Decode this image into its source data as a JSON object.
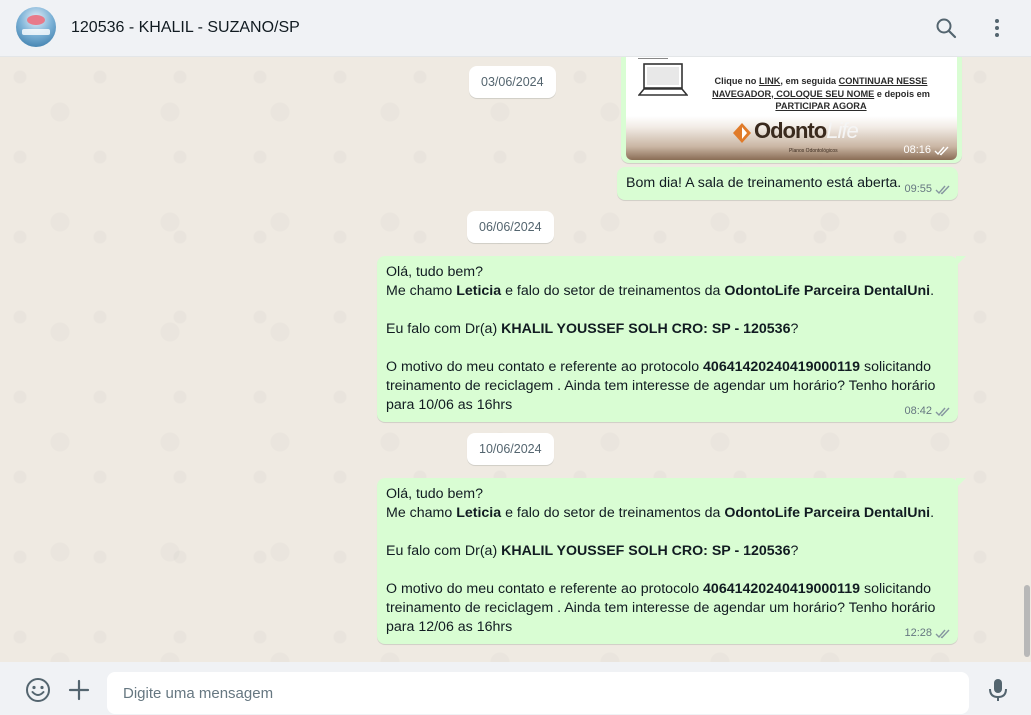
{
  "header": {
    "contact_name": "120536 - KHALIL - SUZANO/SP"
  },
  "image_message": {
    "instruction_lines": [
      [
        "Clique no ",
        "LINK",
        ", em seguida ",
        "CONTINUAR NESSE"
      ],
      [
        "NAVEGADOR, COLOQUE SEU NOME",
        " e depois em"
      ],
      [
        "PARTICIPAR AGORA"
      ]
    ],
    "brand_odonto": "Odonto",
    "brand_life": "Life",
    "brand_tagline": "Planos Odontológicos",
    "time": "08:16"
  },
  "dates": [
    "03/06/2024",
    "06/06/2024",
    "10/06/2024"
  ],
  "messages": [
    {
      "id": "m1",
      "time": "09:55",
      "lines": [
        [
          {
            "t": "Bom dia! A sala de treinamento está aberta.",
            "b": false
          }
        ]
      ]
    },
    {
      "id": "m2",
      "time": "08:42",
      "lines": [
        [
          {
            "t": "Olá, tudo bem?",
            "b": false
          }
        ],
        [
          {
            "t": "Me chamo ",
            "b": false
          },
          {
            "t": "Leticia",
            "b": true
          },
          {
            "t": " e falo do setor de treinamentos  da ",
            "b": false
          },
          {
            "t": "OdontoLife Parceira DentalUni",
            "b": true
          },
          {
            "t": ".",
            "b": false
          }
        ],
        [],
        [
          {
            "t": " Eu falo com Dr(a) ",
            "b": false
          },
          {
            "t": "KHALIL YOUSSEF SOLH CRO: SP - 120536",
            "b": true
          },
          {
            "t": "?",
            "b": false
          }
        ],
        [],
        [
          {
            "t": "O motivo do meu contato e referente ao protocolo ",
            "b": false
          },
          {
            "t": "40641420240419000119",
            "b": true
          },
          {
            "t": " solicitando",
            "b": false
          }
        ],
        [
          {
            "t": "treinamento de reciclagem . Ainda tem interesse de agendar um horário? Tenho horário",
            "b": false
          }
        ],
        [
          {
            "t": "para 10/06 as 16hrs",
            "b": false
          }
        ]
      ]
    },
    {
      "id": "m3",
      "time": "12:28",
      "lines": [
        [
          {
            "t": "Olá, tudo bem?",
            "b": false
          }
        ],
        [
          {
            "t": "Me chamo ",
            "b": false
          },
          {
            "t": "Leticia",
            "b": true
          },
          {
            "t": " e falo do setor de treinamentos  da ",
            "b": false
          },
          {
            "t": "OdontoLife Parceira DentalUni",
            "b": true
          },
          {
            "t": ".",
            "b": false
          }
        ],
        [],
        [
          {
            "t": " Eu falo com Dr(a) ",
            "b": false
          },
          {
            "t": "KHALIL YOUSSEF SOLH CRO: SP - 120536",
            "b": true
          },
          {
            "t": "?",
            "b": false
          }
        ],
        [],
        [
          {
            "t": "O motivo do meu contato e referente ao protocolo ",
            "b": false
          },
          {
            "t": "40641420240419000119",
            "b": true
          },
          {
            "t": " solicitando",
            "b": false
          }
        ],
        [
          {
            "t": "treinamento de reciclagem . Ainda tem interesse de agendar um horário? Tenho horário",
            "b": false
          }
        ],
        [
          {
            "t": "para 12/06 as 16hrs",
            "b": false
          }
        ]
      ]
    }
  ],
  "composer": {
    "placeholder": "Digite uma mensagem"
  },
  "icons": {
    "header": [
      "search-icon",
      "menu-dots-icon"
    ],
    "composer": [
      "emoji-icon",
      "plus-icon",
      "mic-icon"
    ],
    "status": "double-check-icon"
  },
  "colors": {
    "outgoing_bubble": "#d9fdd3",
    "chat_background": "#efeae2",
    "header_background": "#f0f2f5"
  }
}
